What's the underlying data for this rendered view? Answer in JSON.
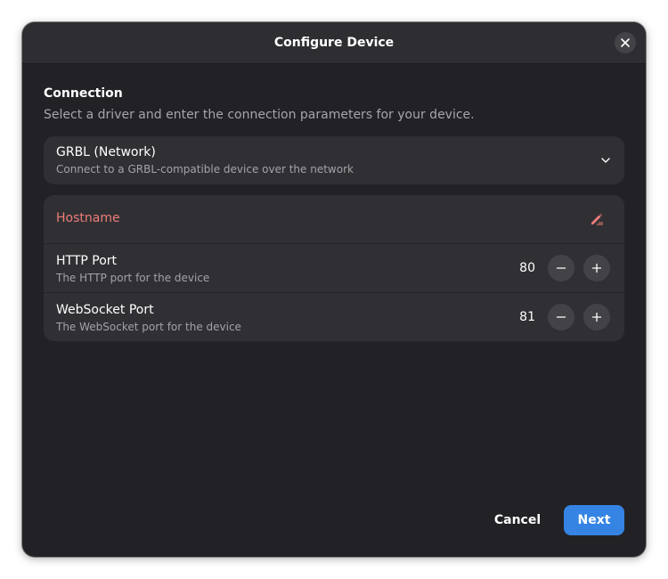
{
  "dialog": {
    "title": "Configure Device"
  },
  "connection": {
    "heading": "Connection",
    "description": "Select a driver and enter the connection parameters for your device."
  },
  "driver": {
    "selected_title": "GRBL (Network)",
    "selected_subtitle": "Connect to a GRBL-compatible device over the network"
  },
  "fields": {
    "hostname": {
      "placeholder": "Hostname",
      "value": ""
    },
    "http_port": {
      "label": "HTTP Port",
      "subtitle": "The HTTP port for the device",
      "value": "80"
    },
    "websocket_port": {
      "label": "WebSocket Port",
      "subtitle": "The WebSocket port for the device",
      "value": "81"
    }
  },
  "footer": {
    "cancel_label": "Cancel",
    "next_label": "Next"
  },
  "colors": {
    "accent": "#3584e4",
    "error": "#ed7d78",
    "dialog_bg": "#222226",
    "row_bg": "#303034"
  }
}
